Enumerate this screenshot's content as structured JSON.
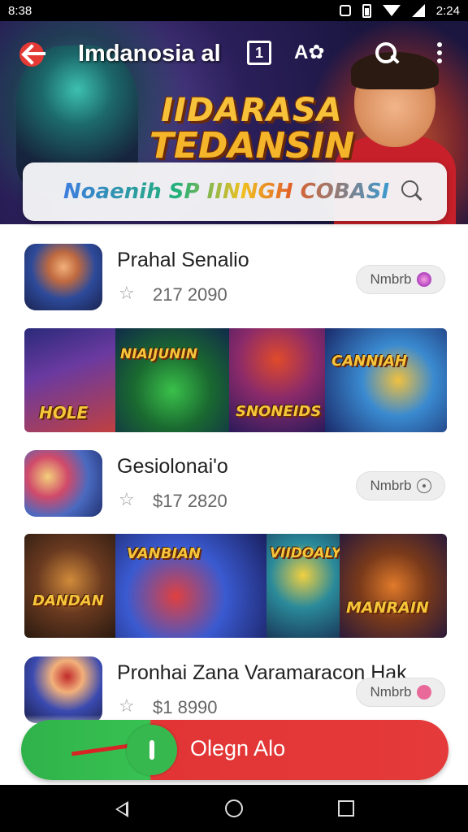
{
  "status_bar": {
    "time_left": "8:38",
    "time_right": "2:24"
  },
  "header": {
    "title": "Imdanosia al",
    "calendar_label": "1",
    "translate_label": "A",
    "hero_line1": "IIDARASA",
    "hero_line2": "TEDANSIN"
  },
  "search": {
    "text": "Noaenih SP IINNGH COBASI"
  },
  "games": [
    {
      "name": "Prahal Senalio",
      "meta": "217 2090",
      "pill": "Nmbrb"
    },
    {
      "name": "Gesiolonai'o",
      "meta": "$17 2820",
      "pill": "Nmbrb"
    },
    {
      "name": "Pronhai Zana Varamaracon Hak",
      "meta": "$1 8990",
      "pill": "Nmbrb"
    }
  ],
  "banners": [
    {
      "labels": [
        "HOLE",
        "NIAIJUNIN",
        "SNONEIDS",
        "CANNIAH"
      ]
    },
    {
      "labels": [
        "DANDAN",
        "VANBIAN",
        "VIIDOALY",
        "MANRAIN"
      ]
    }
  ],
  "cta": {
    "label": "Olegn Alo"
  },
  "colors": {
    "cta_green": "#38c252",
    "cta_red": "#e53a3a",
    "accent": "#f6c63a"
  }
}
